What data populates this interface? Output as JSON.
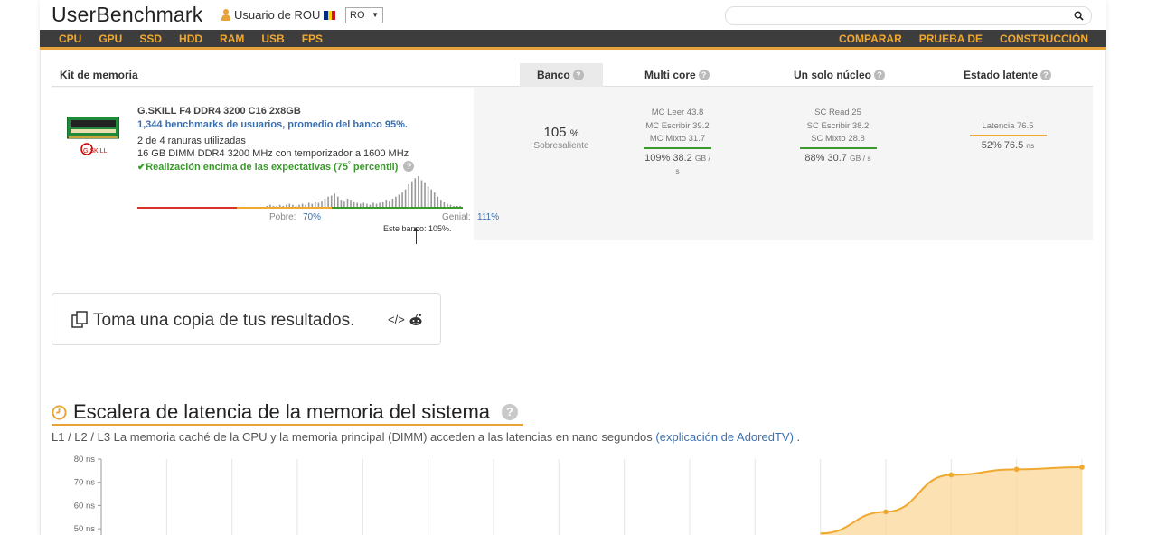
{
  "header": {
    "logo": "UserBenchmark",
    "user": "Usuario de ROU",
    "country_select": "RO",
    "search_placeholder": "",
    "flag_colors": [
      "#002B7F",
      "#FCD116",
      "#CE1126"
    ]
  },
  "nav": {
    "left": [
      "CPU",
      "GPU",
      "SSD",
      "HDD",
      "RAM",
      "USB",
      "FPS"
    ],
    "right": [
      "COMPARAR",
      "PRUEBA DE",
      "CONSTRUCCIÓN"
    ]
  },
  "memtable": {
    "headers": {
      "kit": "Kit de memoria",
      "bank": "Banco",
      "multi": "Multi core",
      "single": "Un solo núcleo",
      "latent": "Estado latente"
    },
    "product": {
      "name": "G.SKILL F4 DDR4 3200 C16 2x8GB",
      "benchmarks": "1,344 benchmarks de usuarios, promedio del banco 95%.",
      "slots": "2 de 4 ranuras utilizadas",
      "spec": "16 GB DIMM DDR4 3200 MHz con temporizador a 1600 MHz",
      "performance": "Realización encima de las expectativas (75",
      "performance_sup": "°",
      "performance_end": " percentil)",
      "poor_label": "Pobre:",
      "poor_value": "70%",
      "great_label": "Genial:",
      "great_value": "111%",
      "bank_pos": "Este banco: 105%.",
      "brand_label": "G.SKILL"
    },
    "bank": {
      "value": "105",
      "unit": "%",
      "label": "Sobresaliente"
    },
    "multi": {
      "lines": [
        "MC Leer 43.8",
        "MC Escribir 39.2",
        "MC Mixto 31.7"
      ],
      "result_pct": "109%",
      "result_val": "38.2",
      "result_unit": "GB / s",
      "bar_color": "#3b9a2c"
    },
    "single": {
      "lines": [
        "SC Read 25",
        "SC Escribir 38.2",
        "SC Mixto 28.8"
      ],
      "result_pct": "88%",
      "result_val": "30.7",
      "result_unit": "GB / s",
      "bar_color": "#3b9a2c"
    },
    "latent": {
      "lines": [
        "Latencia 76.5"
      ],
      "result_pct": "52%",
      "result_val": "76.5",
      "result_unit": "ns",
      "bar_color": "#f0a830"
    },
    "histogram": {
      "bars": [
        1,
        1,
        1,
        1,
        1,
        1,
        1,
        1,
        1,
        1,
        1,
        1,
        1,
        1,
        1,
        1,
        1,
        1,
        1,
        1,
        1,
        1,
        1,
        1,
        1,
        1,
        1,
        1,
        1,
        1,
        1,
        1,
        1,
        1,
        1,
        1,
        1,
        1,
        1,
        1,
        1,
        2,
        1,
        1,
        2,
        1,
        2,
        3,
        2,
        1,
        2,
        3,
        2,
        4,
        3,
        5,
        4,
        6,
        8,
        10,
        11,
        13,
        10,
        7,
        6,
        8,
        7,
        5,
        4,
        3,
        4,
        3,
        2,
        4,
        3,
        4,
        5,
        7,
        6,
        8,
        10,
        12,
        14,
        17,
        22,
        25,
        28,
        30,
        26,
        24,
        20,
        17,
        14,
        10,
        7,
        5,
        3,
        2,
        1,
        1,
        1
      ],
      "colors": {
        "poor": "#d9342b",
        "avg": "#f0a830",
        "great": "#3b9a2c"
      }
    }
  },
  "copybox": {
    "text": "Toma una copia de tus resultados."
  },
  "latency_section": {
    "title": "Escalera de latencia de la memoria del sistema",
    "desc": "L1 / L2 / L3 La memoria caché de la CPU y la memoria principal (DIMM) acceden a las latencias en nano segundos",
    "link": "(explicación de AdoredTV)",
    "desc_end": " .",
    "accent": "#f0a830"
  },
  "chart_data": {
    "type": "area",
    "y_ticks": [
      "80 ns",
      "70 ns",
      "60 ns",
      "50 ns"
    ],
    "ylim": [
      45,
      80
    ],
    "points": [
      {
        "x": 11,
        "y": 48
      },
      {
        "x": 12,
        "y": 57.3
      },
      {
        "x": 13,
        "y": 73.2
      },
      {
        "x": 14,
        "y": 75.6
      },
      {
        "x": 15,
        "y": 76.5
      }
    ],
    "xlim": [
      0,
      15
    ]
  }
}
